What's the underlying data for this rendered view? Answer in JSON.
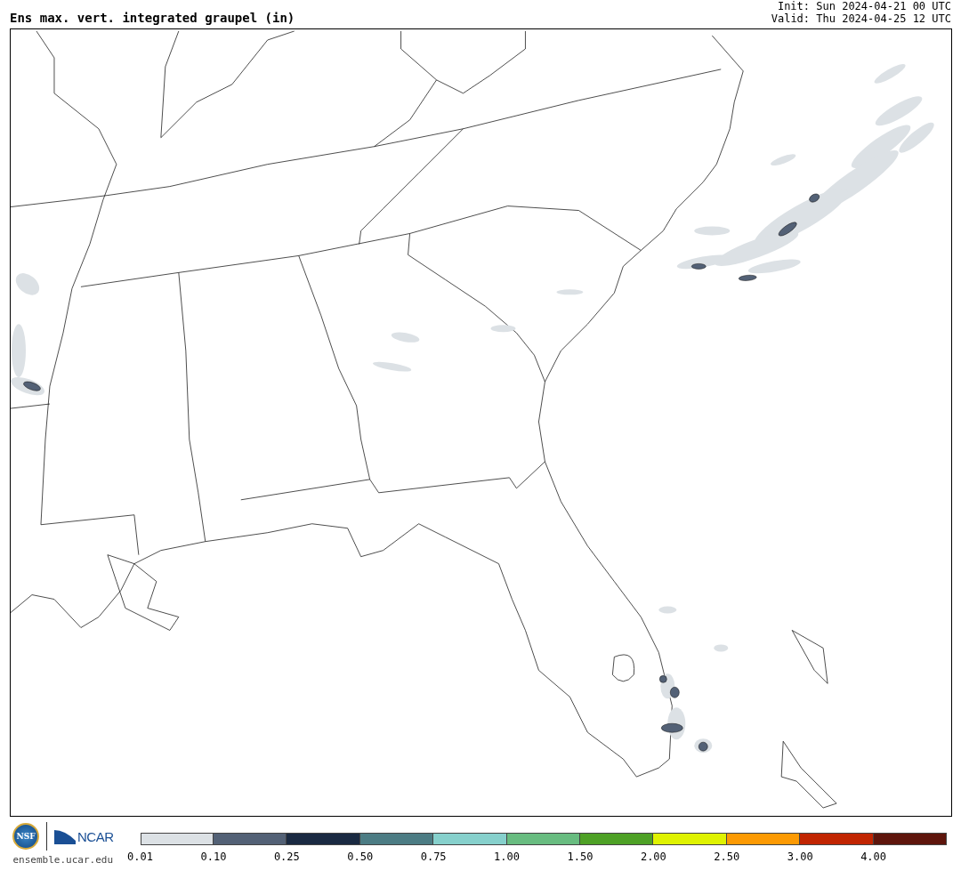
{
  "title": "Ens max. vert. integrated graupel (in)",
  "init": "Init: Sun 2024-04-21 00 UTC",
  "valid": "Valid: Thu 2024-04-25 12 UTC",
  "logos": {
    "nsf": "NSF",
    "ncar": "NCAR"
  },
  "site": "ensemble.ucar.edu",
  "colorbar": [
    {
      "label": "0.01",
      "color": "#dce1e5"
    },
    {
      "label": "0.10",
      "color": "#536176"
    },
    {
      "label": "0.25",
      "color": "#1a2a42"
    },
    {
      "label": "0.50",
      "color": "#4c7c84"
    },
    {
      "label": "0.75",
      "color": "#86d0cc"
    },
    {
      "label": "1.00",
      "color": "#68bc80"
    },
    {
      "label": "1.50",
      "color": "#4ea126"
    },
    {
      "label": "2.00",
      "color": "#dff201"
    },
    {
      "label": "2.50",
      "color": "#fc9a03"
    },
    {
      "label": "3.00",
      "color": "#c12501"
    },
    {
      "label": "4.00",
      "color": "#5e150c"
    }
  ]
}
